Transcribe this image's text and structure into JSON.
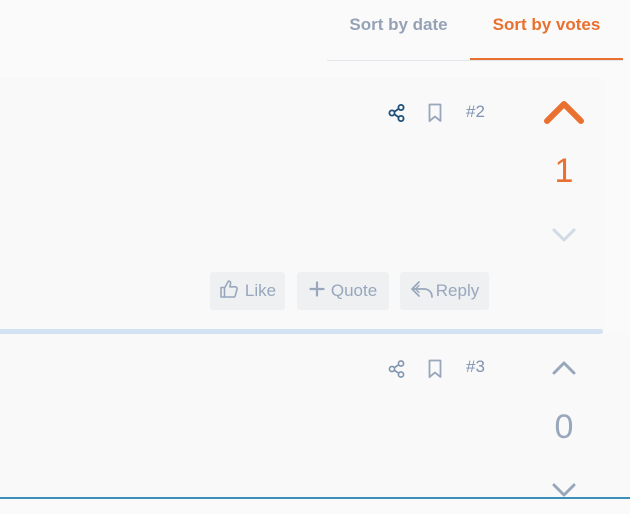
{
  "sort_tabs": {
    "date_label": "Sort by date",
    "votes_label": "Sort by votes",
    "active": "votes"
  },
  "posts": [
    {
      "number": "#2",
      "score": "1",
      "upvoted": true,
      "actions": {
        "like": "Like",
        "quote": "Quote",
        "reply": "Reply"
      }
    },
    {
      "number": "#3",
      "score": "0",
      "upvoted": false
    }
  ],
  "colors": {
    "accent": "#e9702e",
    "muted": "#95a2b6",
    "share_icon": "#1d4f78",
    "border_highlight": "#d3e2f3",
    "bottom_line": "#3b8fb8"
  }
}
